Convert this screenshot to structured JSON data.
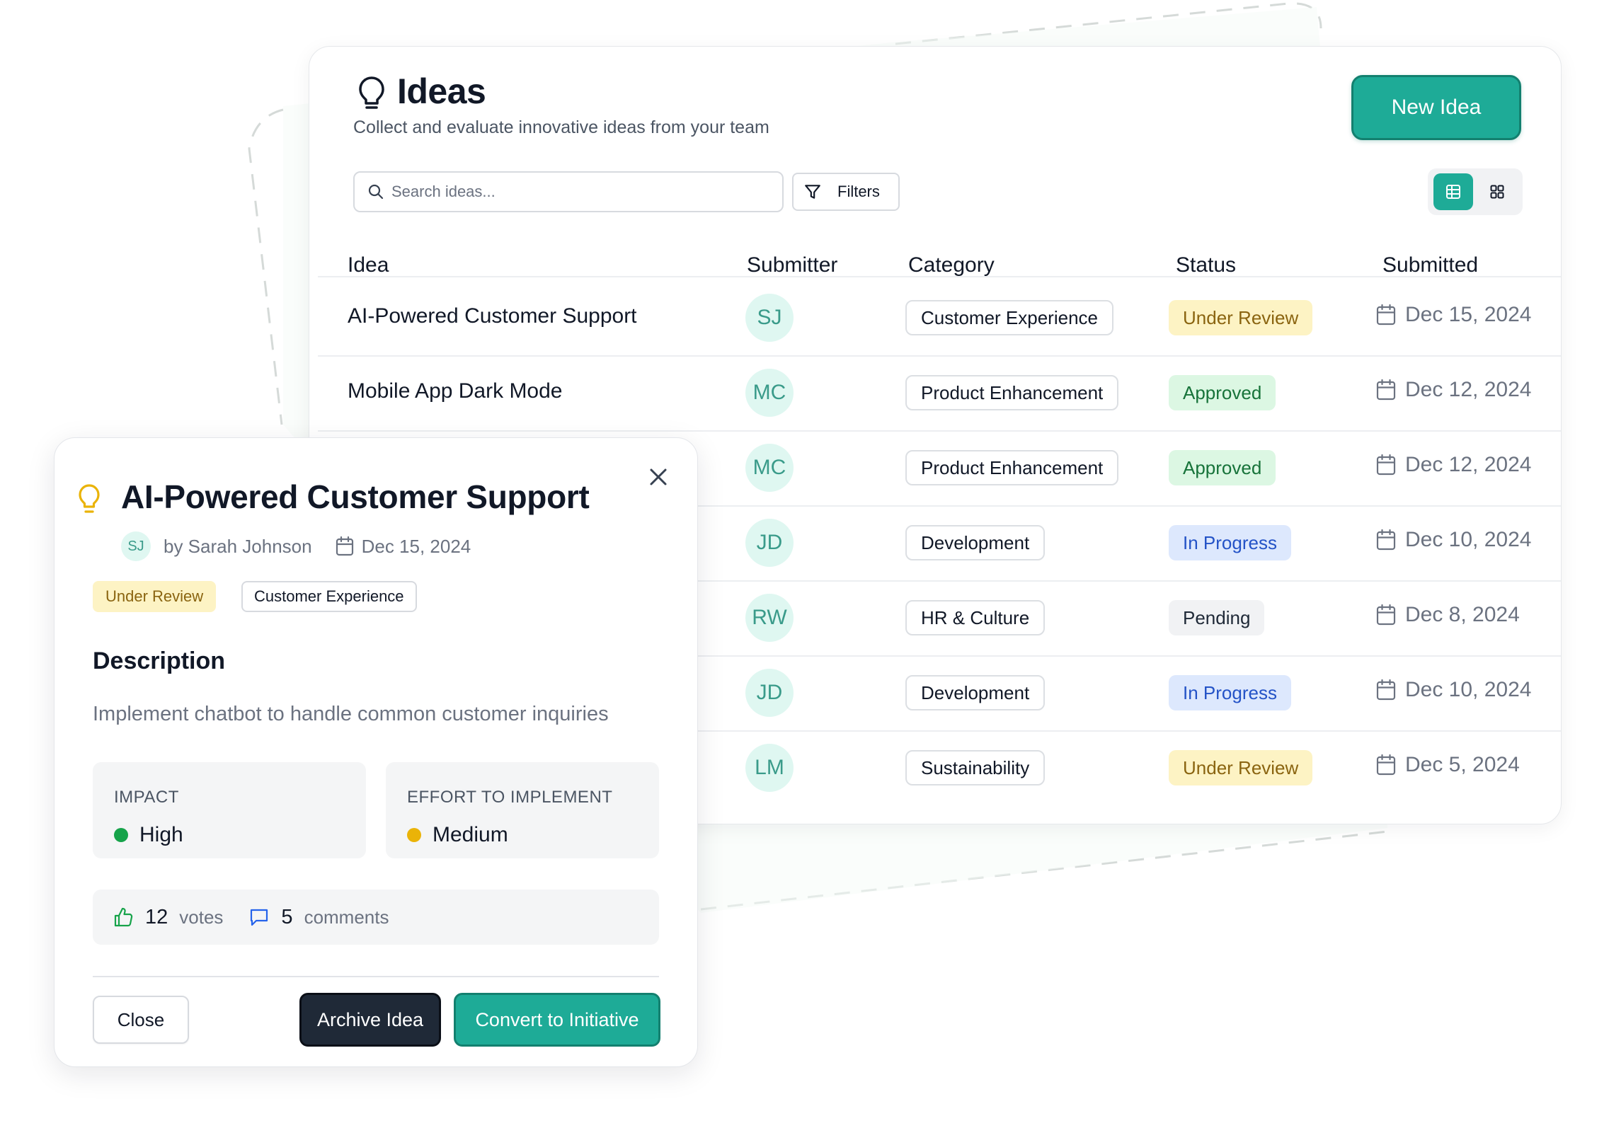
{
  "header": {
    "title": "Ideas",
    "subtitle": "Collect and evaluate innovative ideas from your team",
    "new_idea_label": "New Idea"
  },
  "toolbar": {
    "search_placeholder": "Search ideas...",
    "filters_label": "Filters"
  },
  "view_mode": "table",
  "table": {
    "headers": [
      "Idea",
      "Submitter",
      "Category",
      "Status",
      "Submitted"
    ],
    "rows": [
      {
        "idea": "AI-Powered Customer Support",
        "submitter": "SJ",
        "category": "Customer Experience",
        "status": "Under Review",
        "submitted": "Dec 15, 2024"
      },
      {
        "idea": "Mobile App Dark Mode",
        "submitter": "MC",
        "category": "Product Enhancement",
        "status": "Approved",
        "submitted": "Dec 12, 2024"
      },
      {
        "idea": "",
        "submitter": "MC",
        "category": "Product Enhancement",
        "status": "Approved",
        "submitted": "Dec 12, 2024"
      },
      {
        "idea": "",
        "submitter": "JD",
        "category": "Development",
        "status": "In Progress",
        "submitted": "Dec 10, 2024"
      },
      {
        "idea": "",
        "submitter": "RW",
        "category": "HR & Culture",
        "status": "Pending",
        "submitted": "Dec 8, 2024"
      },
      {
        "idea": "",
        "submitter": "JD",
        "category": "Development",
        "status": "In Progress",
        "submitted": "Dec 10, 2024"
      },
      {
        "idea": "",
        "submitter": "LM",
        "category": "Sustainability",
        "status": "Under Review",
        "submitted": "Dec 5, 2024"
      }
    ]
  },
  "status_colors": {
    "Under Review": {
      "bg": "#fdf3c4",
      "fg": "#8a6410"
    },
    "Approved": {
      "bg": "#dcf7e3",
      "fg": "#17733a"
    },
    "In Progress": {
      "bg": "#dde8fd",
      "fg": "#2453c7"
    },
    "Pending": {
      "bg": "#f1f2f4",
      "fg": "#1f2937"
    }
  },
  "modal": {
    "title": "AI-Powered Customer Support",
    "submitter_initials": "SJ",
    "submitter_text": "by Sarah Johnson",
    "date": "Dec 15, 2024",
    "status": "Under Review",
    "category": "Customer Experience",
    "description_heading": "Description",
    "description": "Implement chatbot to handle common customer inquiries",
    "impact_label": "IMPACT",
    "impact_value": "High",
    "effort_label": "EFFORT TO IMPLEMENT",
    "effort_value": "Medium",
    "votes": "12",
    "votes_label": "votes",
    "comments": "5",
    "comments_label": "comments",
    "close_label": "Close",
    "archive_label": "Archive Idea",
    "convert_label": "Convert to Initiative"
  },
  "colors": {
    "accent": "#1eab97",
    "impact_dot": "#16a34a",
    "effort_dot": "#eab308",
    "bulb_modal": "#eab308"
  },
  "icons": [
    "lightbulb-icon",
    "search-icon",
    "filter-icon",
    "table-view-icon",
    "grid-view-icon",
    "calendar-icon",
    "close-icon",
    "thumbs-up-icon",
    "comment-icon"
  ]
}
